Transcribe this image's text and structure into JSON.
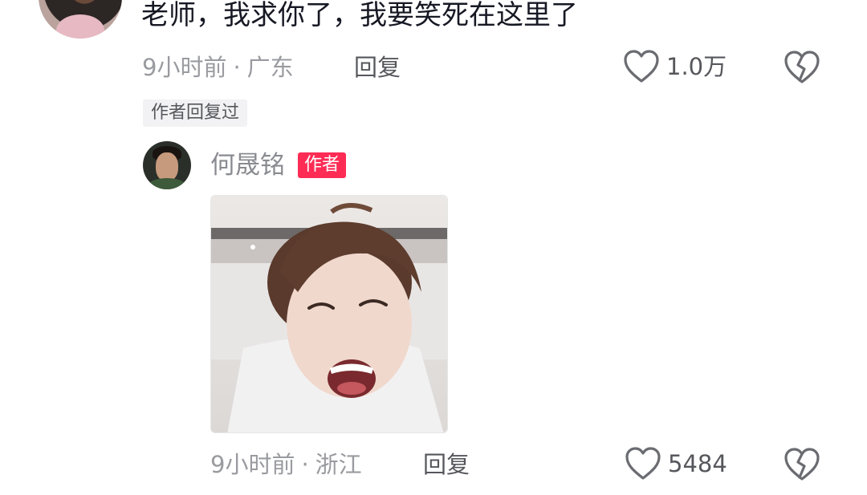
{
  "comment": {
    "text": "老师，我求你了，我要笑死在这里了",
    "time": "9小时前",
    "separator": "·",
    "location": "广东",
    "reply_label": "回复",
    "like_count": "1.0万",
    "author_replied_tag": "作者回复过"
  },
  "reply": {
    "author_name": "何晟铭",
    "author_badge": "作者",
    "time": "9小时前",
    "separator": "·",
    "location": "浙江",
    "reply_label": "回复",
    "like_count": "5484"
  },
  "icons": {
    "like": "heart-outline-icon",
    "dislike": "broken-heart-icon"
  },
  "colors": {
    "badge_red": "#fe2c55",
    "text_primary": "#161823",
    "text_meta": "#9a9ba0",
    "icon_gray": "#6b6c71"
  }
}
